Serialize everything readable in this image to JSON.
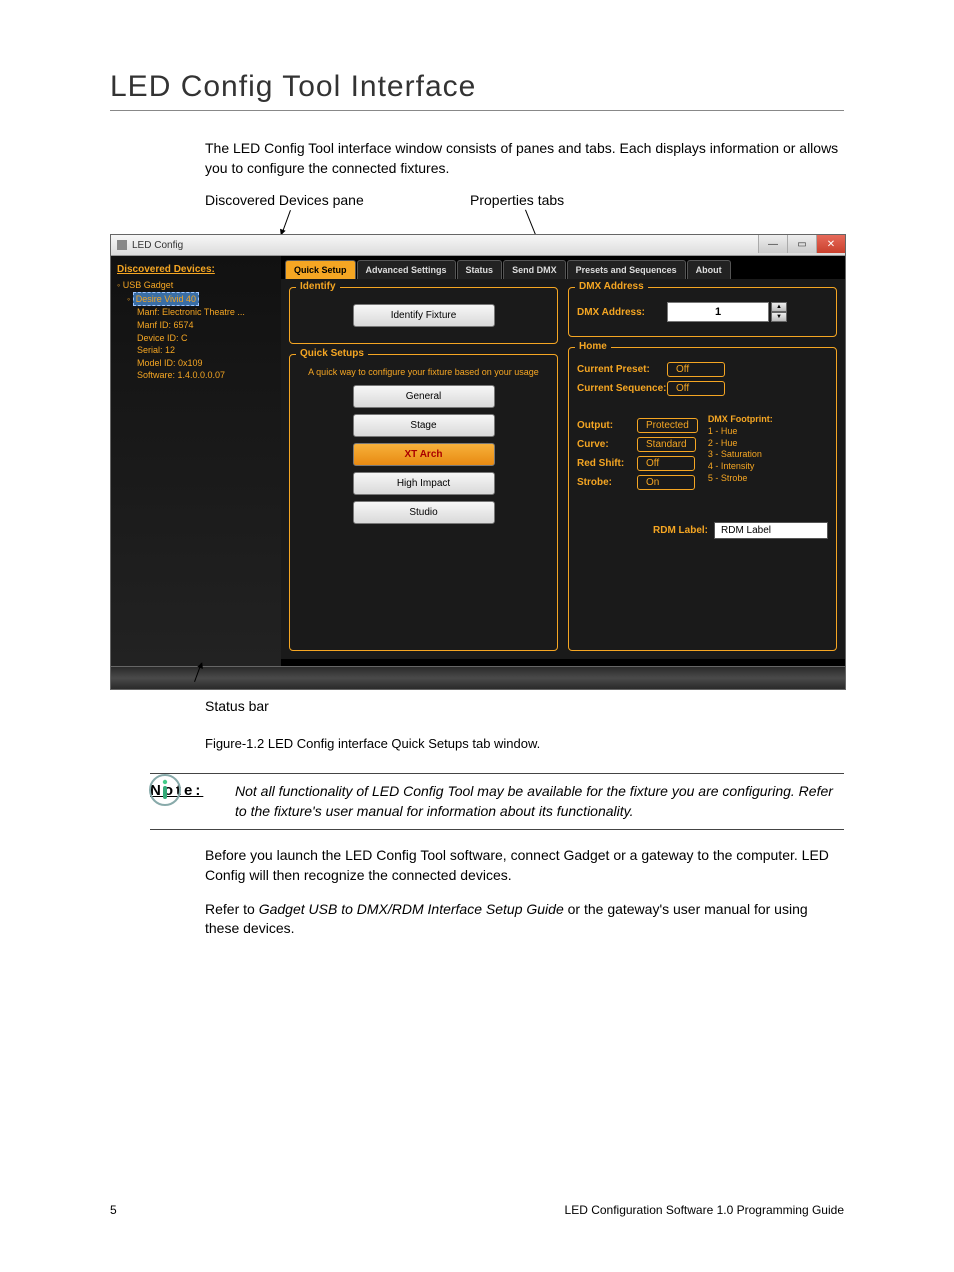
{
  "heading": "LED Config Tool Interface",
  "intro": "The LED Config Tool interface window consists of panes and tabs. Each displays information or allows you to configure the connected fixtures.",
  "callouts": {
    "devices": "Discovered Devices pane",
    "props": "Properties tabs",
    "status": "Status bar"
  },
  "window": {
    "title": "LED Config",
    "tree_title": "Discovered Devices:",
    "tree": {
      "root": "USB Gadget",
      "selected": "Desire Vivid 40",
      "lines": [
        "Manf: Electronic Theatre ...",
        "Manf ID: 6574",
        "Device ID: C",
        "Serial: 12",
        "Model ID: 0x109",
        "Software: 1.4.0.0.0.07"
      ]
    },
    "tabs": [
      "Quick Setup",
      "Advanced Settings",
      "Status",
      "Send DMX",
      "Presets and Sequences",
      "About"
    ],
    "identify": {
      "title": "Identify",
      "button": "Identify Fixture"
    },
    "quick": {
      "title": "Quick Setups",
      "hint": "A quick way to configure your fixture based on your usage",
      "buttons": [
        "General",
        "Stage",
        "XT Arch",
        "High Impact",
        "Studio"
      ],
      "selected": "XT Arch"
    },
    "dmx": {
      "title": "DMX Address",
      "label": "DMX Address:",
      "value": "1"
    },
    "home": {
      "title": "Home",
      "preset_label": "Current Preset:",
      "preset_val": "Off",
      "seq_label": "Current Sequence:",
      "seq_val": "Off",
      "output_label": "Output:",
      "output_val": "Protected",
      "curve_label": "Curve:",
      "curve_val": "Standard",
      "red_label": "Red Shift:",
      "red_val": "Off",
      "strobe_label": "Strobe:",
      "strobe_val": "On",
      "footprint_hdr": "DMX Footprint:",
      "footprint": [
        "1 - Hue",
        "2 - Hue",
        "3 - Saturation",
        "4 - Intensity",
        "5 - Strobe"
      ],
      "rdm_label": "RDM Label:",
      "rdm_value": "RDM Label"
    }
  },
  "caption": "Figure-1.2 LED Config interface Quick Setups tab window.",
  "note_label": "Note:",
  "note_text": "Not all functionality of LED Config Tool may be available for the fixture you are configuring. Refer to the fixture's user manual for information about its functionality.",
  "para2": "Before you launch the LED Config Tool software, connect Gadget or a gateway to the computer. LED Config will then recognize the connected devices.",
  "para3_a": "Refer to ",
  "para3_i": "Gadget USB to DMX/RDM Interface Setup Guide",
  "para3_b": " or the gateway's user manual for using these devices.",
  "footer_left": "5",
  "footer_right": "LED Configuration Software 1.0 Programming Guide"
}
